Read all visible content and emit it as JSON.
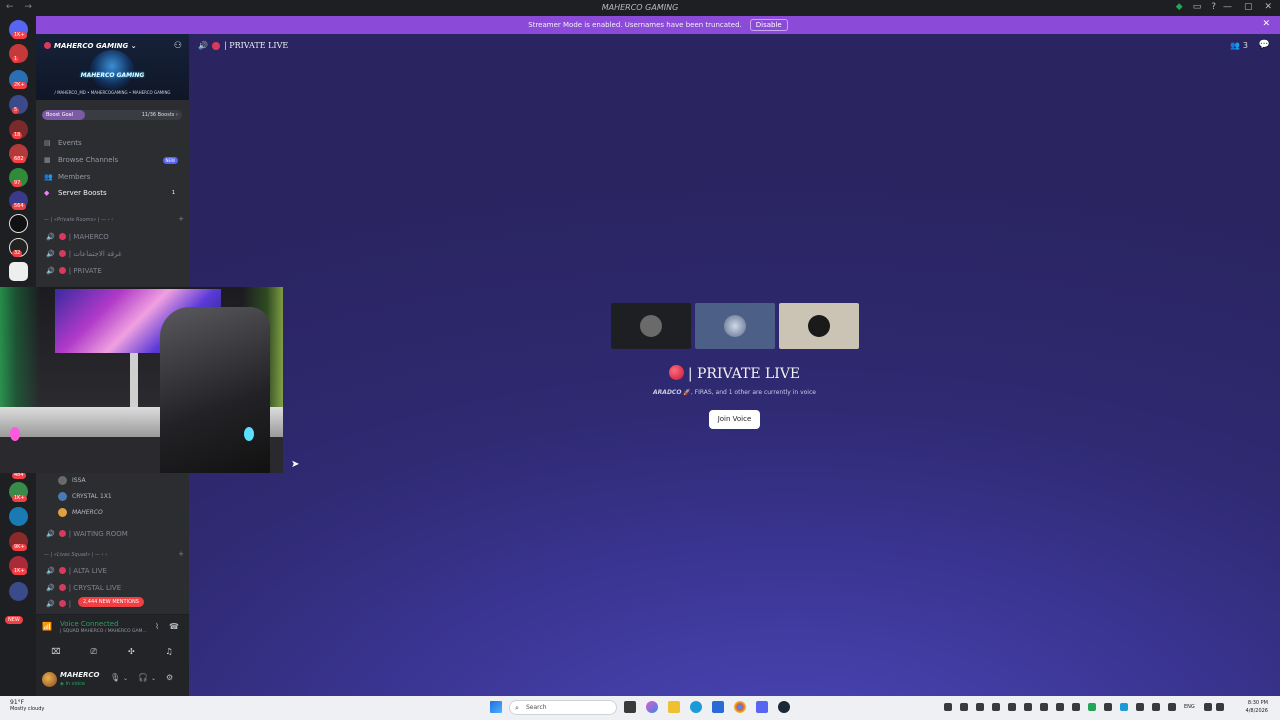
{
  "window": {
    "title": "MAHERCO GAMING",
    "nav": "← →"
  },
  "banner": {
    "text": "Streamer Mode is enabled. Usernames have been truncated.",
    "disable_label": "Disable"
  },
  "rail": {
    "badges": [
      "1K+",
      "1",
      "2K+",
      "5",
      "18",
      "682",
      "97",
      "564",
      "32",
      "484",
      "1K+",
      "9K+",
      "1K+"
    ],
    "new_label": "NEW"
  },
  "server": {
    "name": "MAHERCO GAMING",
    "logo_text": "MAHERCO GAMING",
    "logo_sub": "/ MAHERCO_MD • MAHERCOGAMING • MAHERCO GAMING",
    "boost_label": "Boost Goal",
    "boost_count": "11/36 Boosts",
    "boost_progress": 0.306
  },
  "menu": [
    {
      "label": "Events",
      "icon": "calendar-icon"
    },
    {
      "label": "Browse Channels",
      "icon": "browse-icon",
      "pill": "NEW"
    },
    {
      "label": "Members",
      "icon": "members-icon"
    },
    {
      "label": "Server Boosts",
      "icon": "boost-icon",
      "count": "1"
    }
  ],
  "categories": {
    "private_rooms": "— | «Private Rooms» | — ‹ ‹",
    "lives_squad": "— | «Lives Squad» | — ‹ ‹"
  },
  "voice_channels_top": [
    "| MAHERCO",
    "| غرفة الاجتماعات",
    "| PRIVATE"
  ],
  "voice_users": [
    "ISSA",
    "CRYSTAL 1X1",
    "MAHERCO"
  ],
  "waiting_room": "| WAITING ROOM",
  "voice_channels_bottom": [
    "| ALTA LIVE",
    "| CRYSTAL LIVE",
    "|"
  ],
  "mentions_pill": "2,444 NEW MENTIONS",
  "voice_panel": {
    "status": "Voice Connected",
    "sub": "| SQUAD MAHERCO / MAHERCO GAM...",
    "signal": "📶",
    "noise": "⌇",
    "hangup": "☎"
  },
  "user": {
    "name": "MAHERCO",
    "status": "In voice"
  },
  "main": {
    "channel_name": "| PRIVATE LIVE",
    "people_count": "3",
    "title": "| PRIVATE LIVE",
    "subtitle_name": "ARADCO",
    "subtitle_rest": ", FIRAS, and 1 other are currently in voice",
    "join_label": "Join Voice"
  },
  "taskbar": {
    "temp": "91°F",
    "weather": "Mostly cloudy",
    "search_placeholder": "Search",
    "lang": "ENG",
    "time": "8:30 PM",
    "date": "4/8/2026"
  },
  "colors": {
    "banner": "#8c4ad8",
    "accent_red": "#d83a5b",
    "voice_green": "#23a55a",
    "blurple": "#5865f2"
  }
}
